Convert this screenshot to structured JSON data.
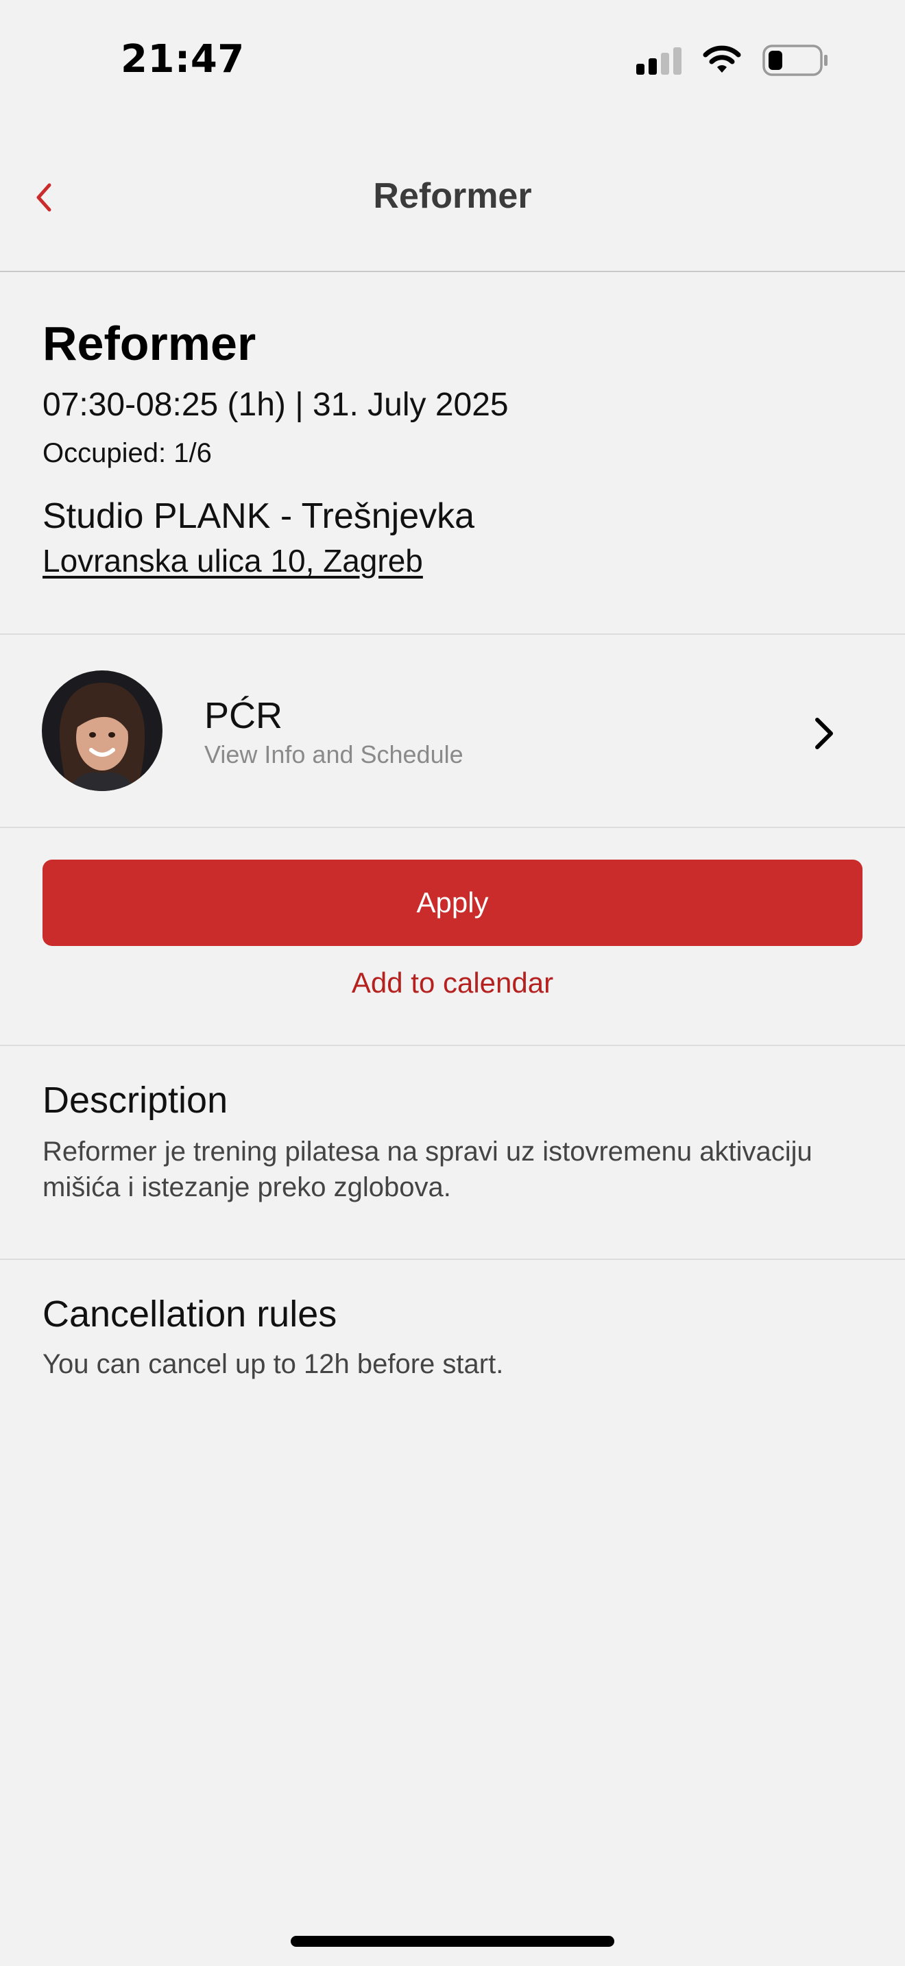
{
  "status_bar": {
    "time": "21:47",
    "icons": [
      "signal-icon",
      "wifi-icon",
      "battery-icon"
    ]
  },
  "nav": {
    "title": "Reformer",
    "back_icon": "chevron-left-icon"
  },
  "class_info": {
    "title": "Reformer",
    "time": "07:30-08:25 (1h) | 31. July 2025",
    "occupied": "Occupied: 1/6",
    "studio": "Studio PLANK - Trešnjevka",
    "address": "Lovranska ulica 10, Zagreb"
  },
  "instructor": {
    "name": "PĆR",
    "subtitle": "View Info and Schedule",
    "icon": "chevron-right-icon"
  },
  "actions": {
    "apply_label": "Apply",
    "calendar_label": "Add to calendar"
  },
  "description": {
    "title": "Description",
    "text": "Reformer je trening pilatesa na spravi uz istovremenu aktivaciju mišića i istezanje preko zglobova."
  },
  "cancellation": {
    "title": "Cancellation rules",
    "text": "You can cancel up to 12h before start."
  },
  "colors": {
    "accent": "#c92c2a",
    "link": "#b5211e",
    "background": "#f2f2f2"
  }
}
